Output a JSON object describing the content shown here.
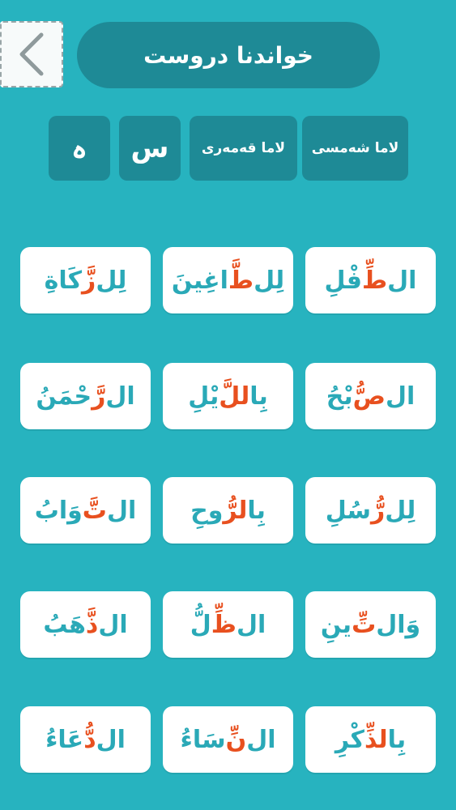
{
  "header": {
    "title": "خواندنا دروست",
    "back_icon": "chevron-left-icon"
  },
  "tabs": {
    "o_label": "ہ",
    "s_label": "س",
    "lunar_label": "لاما قەمەری",
    "solar_label": "لاما شەمسی"
  },
  "colors": {
    "background": "#27b3bf",
    "dark": "#1e8a96",
    "highlight": "#e8501f",
    "text": "#2aa9b7"
  },
  "words": [
    {
      "pre": "ال",
      "hi": "طِّ",
      "post": "فْلِ"
    },
    {
      "pre": "لِل",
      "hi": "طَّ",
      "post": "اغِينَ"
    },
    {
      "pre": "لِل",
      "hi": "زَّ",
      "post": "كَاةِ"
    },
    {
      "pre": "ال",
      "hi": "صُّ",
      "post": "بْحُ"
    },
    {
      "pre": "بِا",
      "hi": "للَّ",
      "post": "يْلِ"
    },
    {
      "pre": "ال",
      "hi": "رَّ",
      "post": "حْمَنُ"
    },
    {
      "pre": "لِل",
      "hi": "رُّ",
      "post": "سُلِ"
    },
    {
      "pre": "بِا",
      "hi": "لرُّ",
      "post": "وحِ"
    },
    {
      "pre": "ال",
      "hi": "تَّ",
      "post": "وَابُ"
    },
    {
      "pre": "وَال",
      "hi": "تِّ",
      "post": "ينِ"
    },
    {
      "pre": "ال",
      "hi": "ظِّ",
      "post": "لُّ"
    },
    {
      "pre": "ال",
      "hi": "ذَّ",
      "post": "هَبُ"
    },
    {
      "pre": "بِا",
      "hi": "لذِّ",
      "post": "كْرِ"
    },
    {
      "pre": "ال",
      "hi": "نِّ",
      "post": "سَاءُ"
    },
    {
      "pre": "ال",
      "hi": "دُّ",
      "post": "عَاءُ"
    }
  ]
}
